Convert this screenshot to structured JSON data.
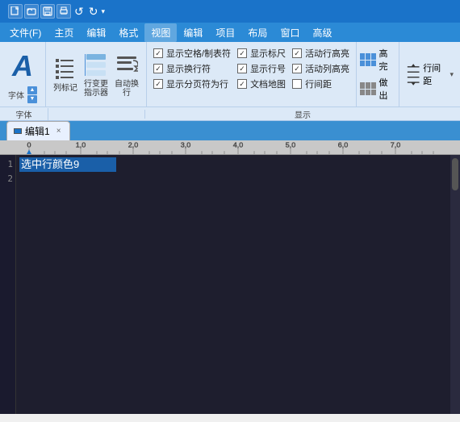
{
  "titlebar": {
    "icons": [
      "▣",
      "📄",
      "💾",
      "🖨",
      "↺",
      "↻"
    ],
    "undo_label": "↺",
    "redo_label": "↻",
    "dropdown_label": "▾"
  },
  "menubar": {
    "items": [
      "文件(F)",
      "主页",
      "编辑",
      "格式",
      "视图",
      "编辑",
      "项目",
      "布局",
      "窗口",
      "高级"
    ]
  },
  "ribbon": {
    "font_label": "字体",
    "font_letter": "A",
    "icon_buttons": [
      {
        "label": "列标记",
        "id": "list-mark"
      },
      {
        "label": "行变更指示器",
        "id": "line-change"
      },
      {
        "label": "自动换行",
        "id": "auto-wrap"
      }
    ],
    "checkboxes": {
      "col1": [
        {
          "label": "显示空格/制表符",
          "checked": true
        },
        {
          "label": "显示换行符",
          "checked": true
        },
        {
          "label": "显示分页符为行",
          "checked": true
        }
      ],
      "col2": [
        {
          "label": "显示标尺",
          "checked": true
        },
        {
          "label": "显示行号",
          "checked": true
        },
        {
          "label": "文档地图",
          "checked": true
        }
      ],
      "col3": [
        {
          "label": "活动行高亮",
          "checked": true
        },
        {
          "label": "活动列高亮",
          "checked": false
        },
        {
          "label": "行间距",
          "checked": false
        }
      ]
    },
    "right_buttons": [
      {
        "label": "高完",
        "id": "high-complete"
      },
      {
        "label": "做出",
        "id": "make-out"
      }
    ],
    "display_label": "显示",
    "line_spacing_label": "行间距"
  },
  "tabs": [
    {
      "label": "编辑1",
      "active": true,
      "closeable": true
    }
  ],
  "editor": {
    "line1_text": "选中行颜色9",
    "line_numbers": [
      "1",
      "2"
    ]
  }
}
